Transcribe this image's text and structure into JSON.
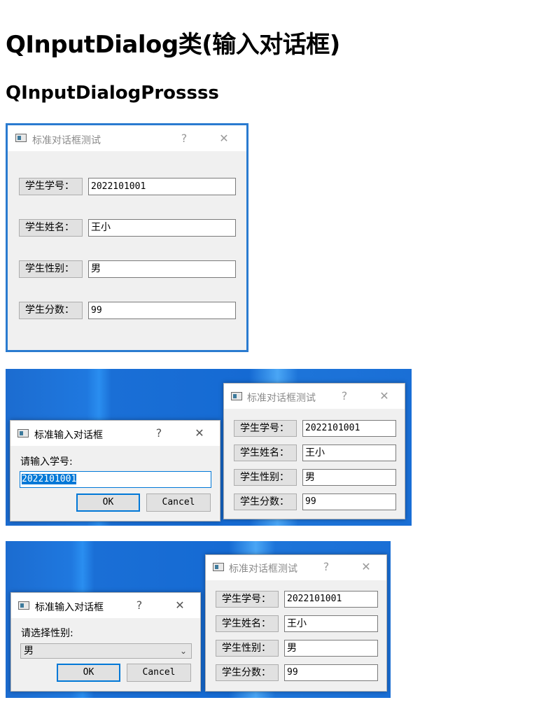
{
  "headings": {
    "title": "QInputDialog类(输入对话框)",
    "subtitle": "QInputDialogProssss"
  },
  "main_dialog": {
    "title": "标准对话框测试",
    "help": "?",
    "close": "✕",
    "rows": [
      {
        "label": "学生学号：",
        "value": "2022101001"
      },
      {
        "label": "学生姓名：",
        "value": "王小"
      },
      {
        "label": "学生性别：",
        "value": "男"
      },
      {
        "label": "学生分数：",
        "value": "99"
      }
    ]
  },
  "shot2": {
    "input_dialog": {
      "title": "标准输入对话框",
      "help": "?",
      "close": "✕",
      "prompt": "请输入学号:",
      "value": "2022101001",
      "ok": "OK",
      "cancel": "Cancel"
    },
    "bg_dialog": {
      "title": "标准对话框测试",
      "help": "?",
      "close": "✕",
      "rows": [
        {
          "label": "学生学号：",
          "value": "2022101001"
        },
        {
          "label": "学生姓名：",
          "value": "王小"
        },
        {
          "label": "学生性别：",
          "value": "男"
        },
        {
          "label": "学生分数：",
          "value": "99"
        }
      ]
    }
  },
  "shot3": {
    "input_dialog": {
      "title": "标准输入对话框",
      "help": "?",
      "close": "✕",
      "prompt": "请选择性别:",
      "value": "男",
      "ok": "OK",
      "cancel": "Cancel"
    },
    "bg_dialog": {
      "title": "标准对话框测试",
      "help": "?",
      "close": "✕",
      "rows": [
        {
          "label": "学生学号：",
          "value": "2022101001"
        },
        {
          "label": "学生姓名：",
          "value": "王小"
        },
        {
          "label": "学生性别：",
          "value": "男"
        },
        {
          "label": "学生分数：",
          "value": "99"
        }
      ]
    }
  },
  "colors": {
    "desktop": "#1a6fd6",
    "accent": "#0078d7",
    "dialog_bg": "#f0f0f0"
  }
}
